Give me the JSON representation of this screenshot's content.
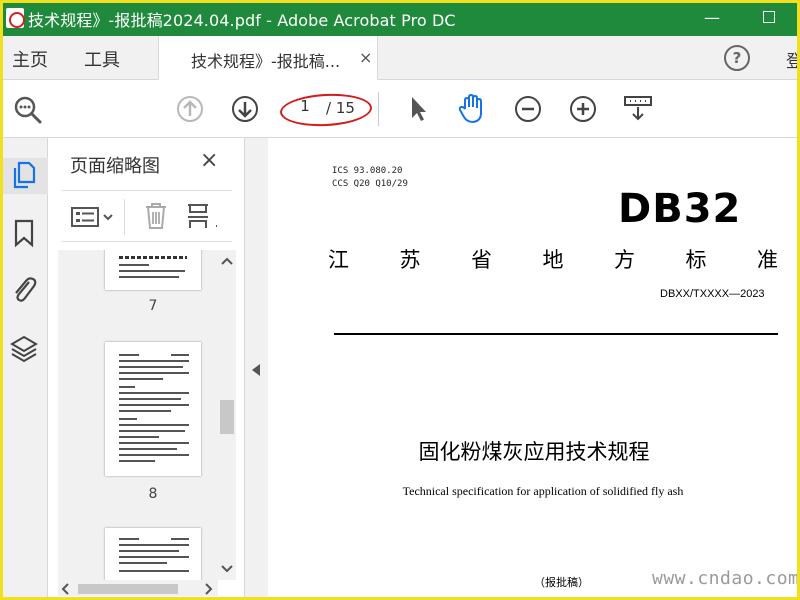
{
  "window": {
    "title": "技术规程》-报批稿2024.04.pdf - Adobe Acrobat Pro DC",
    "minimize_glyph": "—"
  },
  "menu": {
    "home": "主页",
    "tools": "工具",
    "doc_tab": "技术规程》-报批稿...",
    "doc_tab_close": "×",
    "help": "?",
    "login": "登"
  },
  "toolbar": {
    "current_page": "1",
    "total_pages": "/ 15",
    "icons": [
      "zoom-search-icon",
      "page-up-icon",
      "page-down-icon",
      "select-arrow-icon",
      "hand-tool-icon",
      "zoom-out-icon",
      "zoom-in-icon",
      "scroll-mode-icon"
    ],
    "highlight_color": "#d41c1c"
  },
  "rail": {
    "icons": [
      "page-thumbnails-icon",
      "bookmarks-icon",
      "attachments-icon",
      "layers-icon"
    ],
    "accent_color": "#1473e6"
  },
  "thumbnails_panel": {
    "title": "页面缩略图",
    "close": "×",
    "pages": [
      {
        "label": "7"
      },
      {
        "label": "8"
      }
    ]
  },
  "document": {
    "ics": "ICS  93.080.20",
    "ccs": "CCS  Q20 Q10/29",
    "logo": "DB32",
    "standard_title_chars": [
      "江",
      "苏",
      "省",
      "地",
      "方",
      "标",
      "准"
    ],
    "standard_number": "DBXX/TXXXX—2023",
    "title": "固化粉煤灰应用技术规程",
    "subtitle": "Technical specification for application of solidified fly ash",
    "draft": "（报批稿）"
  },
  "watermark": "www.cndao.com",
  "colors": {
    "titlebar": "#1f8a3c",
    "frame": "#f0e020"
  }
}
